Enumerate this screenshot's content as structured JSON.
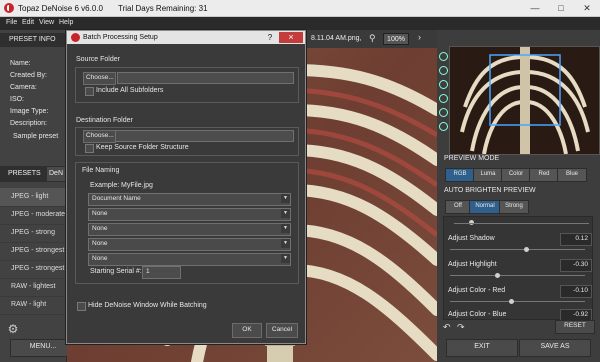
{
  "app": {
    "title": "Topaz DeNoise 6 v6.0.0",
    "trial": "Trial Days Remaining: 31"
  },
  "menu": [
    "File",
    "Edit",
    "View",
    "Help"
  ],
  "left": {
    "preset_info_header": "PRESET INFO",
    "info_labels": [
      "Name:",
      "Created By:",
      "Camera:",
      "ISO:",
      "Image Type:",
      "Description:"
    ],
    "sample_preset": "Sample preset",
    "presets_tab": "PRESETS",
    "denoise_tab": "DeN",
    "presets": [
      "JPEG - light",
      "JPEG - moderate",
      "JPEG - strong",
      "JPEG - strongest",
      "JPEG - strongest",
      "RAW - lightest",
      "RAW - light"
    ],
    "menu_button": "MENU..."
  },
  "image": {
    "filename": "8.11.04 AM.png,",
    "zoom": "100%"
  },
  "right": {
    "preview_mode_label": "PREVIEW MODE",
    "preview_modes": [
      "RGB",
      "Luma",
      "Color",
      "Red",
      "Blue"
    ],
    "auto_brighten_label": "AUTO BRIGHTEN PREVIEW",
    "brighten_modes": [
      "Off",
      "Normal",
      "Strong"
    ],
    "sliders": [
      {
        "label": "Adjust Shadow",
        "value": "0.12",
        "level": 0.56
      },
      {
        "label": "Adjust Highlight",
        "value": "-0.30",
        "level": 0.35
      },
      {
        "label": "Adjust Color - Red",
        "value": "-0.10",
        "level": 0.45
      },
      {
        "label": "Adjust Color - Blue",
        "value": "-0.92",
        "level": 0.04
      }
    ],
    "reset_button": "RESET"
  },
  "bottom": {
    "exit_button": "EXIT",
    "save_button": "SAVE AS"
  },
  "dialog": {
    "title": "Batch Processing Setup",
    "help_icon": "?",
    "close_icon": "×",
    "source_folder_label": "Source Folder",
    "choose_label": "Choose...",
    "include_subfolders": "Include All Subfolders",
    "destination_label": "Destination Folder",
    "choose_label2": "Choose...",
    "keep_structure": "Keep Source Folder Structure",
    "file_naming_label": "File Naming",
    "example_label": "Example:",
    "example_value": "MyFile.jpg",
    "naming_options": [
      "Document Name",
      "None",
      "None",
      "None",
      "None"
    ],
    "starting_serial_label": "Starting Serial #:",
    "starting_serial_value": "1",
    "hide_window": "Hide DeNoise Window While Batching",
    "ok": "OK",
    "cancel": "Cancel"
  }
}
